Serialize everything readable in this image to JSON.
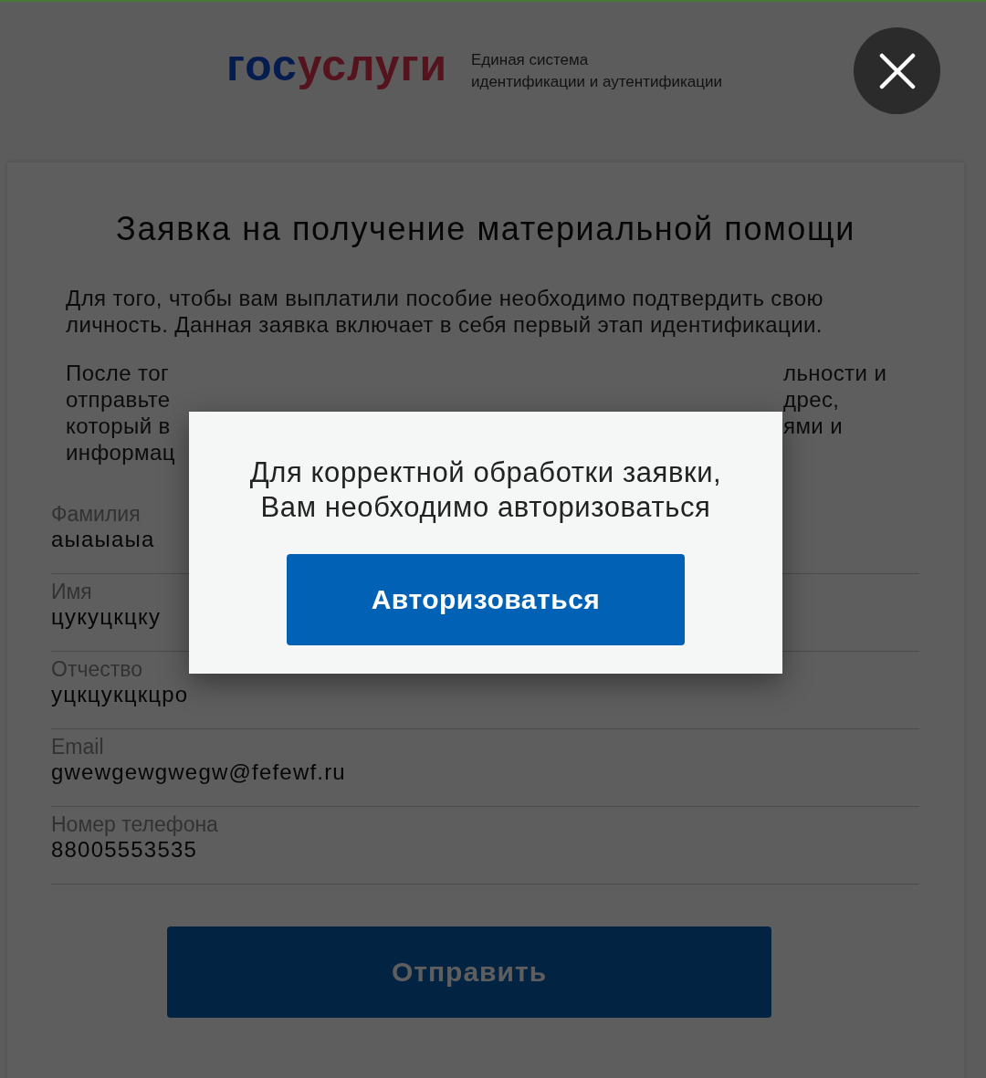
{
  "header": {
    "logo": [
      {
        "text": "гос",
        "color": "#051c4e"
      },
      {
        "text": "услуги",
        "color": "#54131d"
      }
    ],
    "tagline": [
      "Единая система",
      "идентификации и аутентификации"
    ]
  },
  "form": {
    "title": "Заявка на получение материальной помощи",
    "intro": "Для того, чтобы вам выплатили пособие необходимо подтвердить свою личность. Данная заявка включает в себя первый этап идентификации.",
    "partly_covered_lines": [
      {
        "left": "После тог",
        "right": "льности и"
      },
      {
        "left": "отправьте",
        "right": "дрес,"
      },
      {
        "left": "который в",
        "right": "ями и"
      },
      {
        "left": "информац"
      }
    ],
    "fields": [
      {
        "label": "Фамилия",
        "value": "аыаыаыа"
      },
      {
        "label": "Имя",
        "value": "цукуцкцку"
      },
      {
        "label": "Отчество",
        "value": "уцкцукцкцро"
      },
      {
        "label": "Email",
        "value": "gwewgewgwegw@fefewf.ru"
      },
      {
        "label": "Номер телефона",
        "value": "88005553535"
      }
    ],
    "submit": "Отправить"
  },
  "dialog": {
    "message": [
      "Для корректной обработки заявки,",
      "Вам необходимо авторизоваться"
    ],
    "button": "Авторизоваться"
  }
}
